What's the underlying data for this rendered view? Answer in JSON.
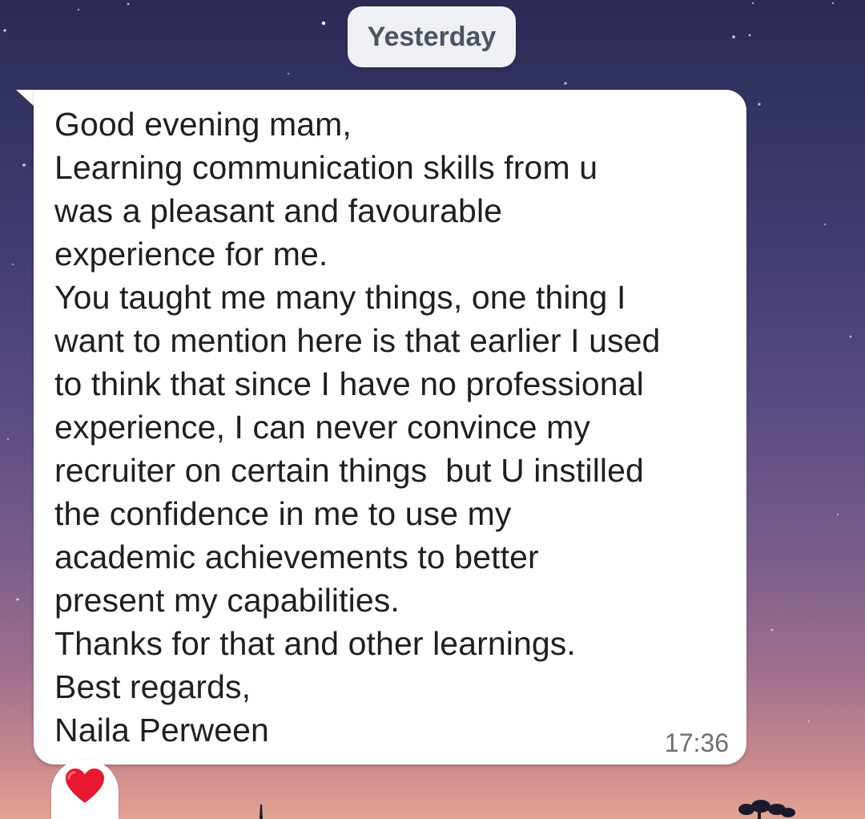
{
  "chat": {
    "date_chip": "Yesterday",
    "message": {
      "lines": [
        "Good evening mam,",
        "Learning communication skills from u",
        "was a pleasant and favourable",
        "experience for me.",
        "You taught me many things, one thing I",
        "want to mention here is that earlier I used",
        "to think that since I have no professional",
        "experience, I can never convince my",
        "recruiter on certain things  but U instilled",
        "the confidence in me to use my",
        "academic achievements to better",
        "present my capabilities.",
        "Thanks for that and other learnings.",
        "Best regards,",
        "Naila Perween"
      ],
      "time": "17:36"
    },
    "reaction": {
      "icon": "red-heart-icon",
      "color": "#e8182f"
    }
  },
  "colors": {
    "bubble": "#ffffff",
    "date_chip": "#eef0f3",
    "text": "#1f1f1f",
    "timestamp": "#6e6e6e"
  }
}
